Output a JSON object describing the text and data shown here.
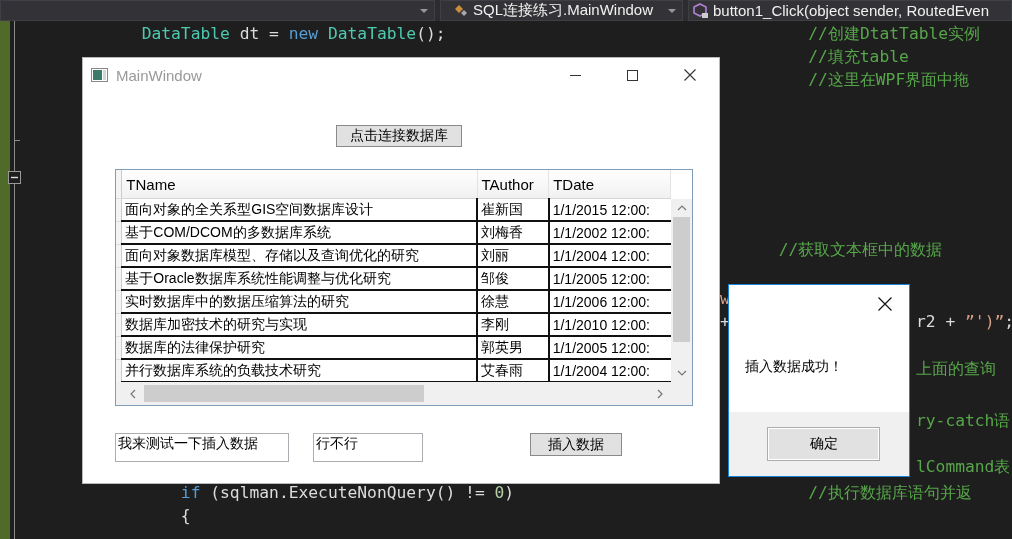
{
  "editor_toolbar": {
    "dropdowns": [
      {
        "text": "SQL连接练习.MainWindow"
      },
      {
        "text": "button1_Click(object sender, RoutedEven"
      }
    ]
  },
  "editor": {
    "lines": [
      {
        "tokens": [
          {
            "text": "            DataTable",
            "kind": "type"
          },
          {
            "text": " dt = ",
            "kind": "plain"
          },
          {
            "text": "new",
            "kind": "keyword"
          },
          {
            "text": " DataTable",
            "kind": "type"
          },
          {
            "text": "();",
            "kind": "plain"
          },
          {
            "text": "                                     //创建DtatTable实例",
            "kind": "comment"
          }
        ]
      },
      {
        "tokens": [
          {
            "text": "                                                                                //填充table",
            "kind": "comment"
          }
        ]
      },
      {
        "tokens": [
          {
            "text": "                                                                                //这里在WPF界面中拖",
            "kind": "comment"
          }
        ]
      },
      {
        "tokens": [
          {
            "text": "                                                                             //获取文本框中的数据",
            "kind": "comment"
          }
        ]
      },
      {
        "tokens": [
          {
            "text": "                                                                       w",
            "kind": "string"
          }
        ]
      },
      {
        "tokens": [
          {
            "text": "                                                                       +",
            "kind": "plain"
          },
          {
            "text": "                   r2 + ",
            "kind": "plain"
          },
          {
            "text": "”')”",
            "kind": "string"
          },
          {
            "text": ";",
            "kind": "plain"
          }
        ]
      },
      {
        "tokens": [
          {
            "text": "                                                                                           上面的查询",
            "kind": "comment"
          }
        ]
      },
      {
        "tokens": [
          {
            "text": "                                                                                           ry-catch语",
            "kind": "comment"
          }
        ]
      },
      {
        "tokens": [
          {
            "text": "                                                                                           lCommand表",
            "kind": "comment"
          }
        ]
      },
      {
        "tokens": [
          {
            "text": "                if",
            "kind": "keyword"
          },
          {
            "text": " (sqlman.ExecuteNonQuery() != ",
            "kind": "plain"
          },
          {
            "text": "0",
            "kind": "number"
          },
          {
            "text": ")",
            "kind": "plain"
          },
          {
            "text": "                              //执行数据库语句并返",
            "kind": "comment"
          }
        ]
      },
      {
        "tokens": [
          {
            "text": "                {",
            "kind": "plain"
          }
        ]
      }
    ]
  },
  "main_window": {
    "title": "MainWindow",
    "connect_button": "点击连接数据库",
    "table": {
      "columns": [
        "TName",
        "TAuthor",
        "TDate"
      ],
      "rows": [
        [
          "面向对象的全关系型GIS空间数据库设计",
          "崔新国",
          "1/1/2015 12:00:"
        ],
        [
          "基于COM/DCOM的多数据库系统",
          "刘梅香",
          "1/1/2002 12:00:"
        ],
        [
          "面向对象数据库模型、存储以及查询优化的研究",
          "刘丽",
          "1/1/2004 12:00:"
        ],
        [
          "基于Oracle数据库系统性能调整与优化研究",
          "邹俊",
          "1/1/2005 12:00:"
        ],
        [
          "实时数据库中的数据压缩算法的研究",
          "徐慧",
          "1/1/2006 12:00:"
        ],
        [
          "数据库加密技术的研究与实现",
          "李刚",
          "1/1/2010 12:00:"
        ],
        [
          "数据库的法律保护研究",
          "郭英男",
          "1/1/2005 12:00:"
        ],
        [
          "并行数据库系统的负载技术研究",
          "艾春雨",
          "1/1/2004 12:00:"
        ]
      ]
    },
    "inputs": [
      {
        "value": "我来测试一下插入数据"
      },
      {
        "value": "行不行"
      }
    ],
    "insert_button": "插入数据"
  },
  "message_box": {
    "message": "插入数据成功！",
    "ok_button": "确定"
  }
}
